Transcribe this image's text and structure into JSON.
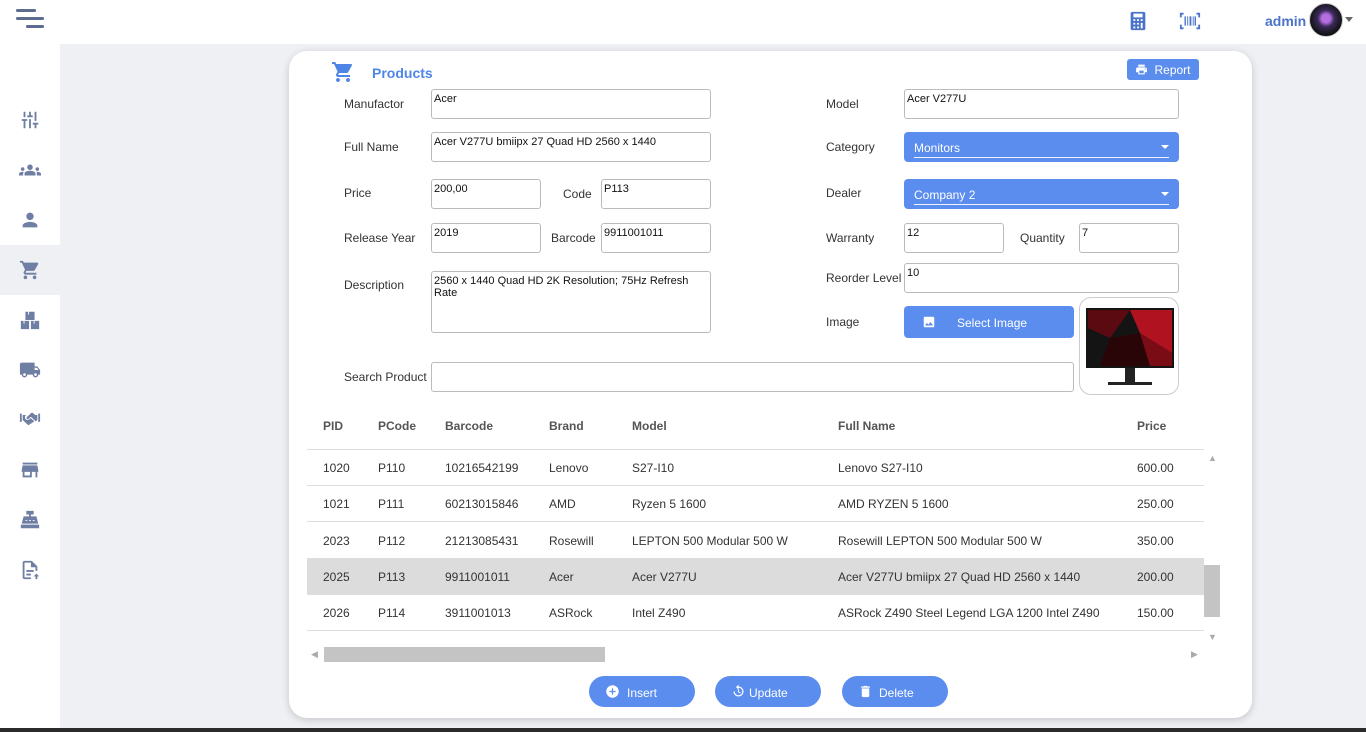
{
  "topbar": {
    "user_name": "admin",
    "icons": [
      "menu-icon",
      "calculator-icon",
      "barcode-icon",
      "avatar",
      "chevron-down-icon"
    ]
  },
  "sidebar": {
    "items": [
      {
        "icon": "sliders-icon"
      },
      {
        "icon": "users-group-icon"
      },
      {
        "icon": "user-icon"
      },
      {
        "icon": "cart-icon",
        "active": true
      },
      {
        "icon": "boxes-icon"
      },
      {
        "icon": "truck-icon"
      },
      {
        "icon": "handshake-icon"
      },
      {
        "icon": "store-icon"
      },
      {
        "icon": "cash-register-icon"
      },
      {
        "icon": "file-upload-icon"
      }
    ]
  },
  "page": {
    "title": "Products",
    "report_label": "Report"
  },
  "form": {
    "manufactor": {
      "label": "Manufactor",
      "value": "Acer"
    },
    "full_name": {
      "label": "Full Name",
      "value": "Acer V277U bmiipx 27 Quad HD 2560 x 1440"
    },
    "price": {
      "label": "Price",
      "value": "200,00"
    },
    "code": {
      "label": "Code",
      "value": "P113"
    },
    "release_year": {
      "label": "Release Year",
      "value": "2019"
    },
    "barcode": {
      "label": "Barcode",
      "value": "9911001011"
    },
    "description": {
      "label": "Description",
      "value": "2560 x 1440 Quad HD 2K Resolution; 75Hz Refresh Rate"
    },
    "model": {
      "label": "Model",
      "value": "Acer V277U"
    },
    "category": {
      "label": "Category",
      "value": "Monitors"
    },
    "dealer": {
      "label": "Dealer",
      "value": "Company 2"
    },
    "warranty": {
      "label": "Warranty",
      "value": "12"
    },
    "quantity": {
      "label": "Quantity",
      "value": "7"
    },
    "reorder_level": {
      "label": "Reorder Level",
      "value": "10"
    },
    "image": {
      "label": "Image",
      "button_label": "Select Image"
    },
    "search": {
      "label": "Search Product",
      "value": ""
    }
  },
  "table": {
    "columns": [
      "PID",
      "PCode",
      "Barcode",
      "Brand",
      "Model",
      "Full Name",
      "Price"
    ],
    "rows": [
      {
        "pid": "1020",
        "pcode": "P110",
        "barcode": "10216542199",
        "brand": "Lenovo",
        "model": "S27-I10",
        "full_name": "Lenovo S27-I10",
        "price": "600.00"
      },
      {
        "pid": "1021",
        "pcode": "P111",
        "barcode": "60213015846",
        "brand": "AMD",
        "model": "Ryzen 5 1600",
        "full_name": "AMD RYZEN 5 1600",
        "price": "250.00"
      },
      {
        "pid": "2023",
        "pcode": "P112",
        "barcode": "21213085431",
        "brand": "Rosewill",
        "model": "LEPTON 500 Modular 500 W",
        "full_name": "Rosewill LEPTON 500 Modular 500 W",
        "price": "350.00"
      },
      {
        "pid": "2025",
        "pcode": "P113",
        "barcode": "9911001011",
        "brand": "Acer",
        "model": "Acer V277U",
        "full_name": "Acer V277U bmiipx 27 Quad HD 2560 x 1440",
        "price": "200.00",
        "selected": true
      },
      {
        "pid": "2026",
        "pcode": "P114",
        "barcode": "3911001013",
        "brand": "ASRock",
        "model": "Intel Z490",
        "full_name": "ASRock Z490 Steel Legend LGA 1200 Intel Z490",
        "price": "150.00"
      }
    ]
  },
  "actions": {
    "insert": "Insert",
    "update": "Update",
    "delete": "Delete"
  },
  "colors": {
    "accent": "#5b8def",
    "title": "#4f86e6",
    "sidebar_icon": "#6f7ea3",
    "selected_row": "#dcdcdc"
  }
}
